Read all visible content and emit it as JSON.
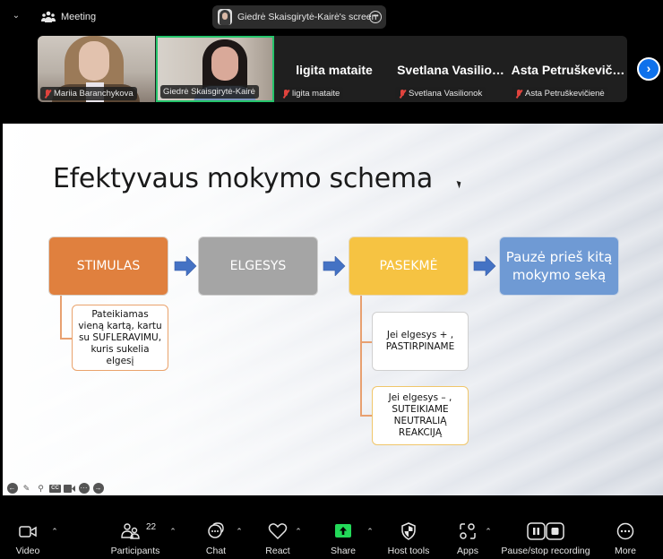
{
  "topbar": {
    "meeting_label": "Meeting",
    "screen_share_label": "Giedrė Skaisgirytė-Kairė's screen",
    "icons": {
      "collapse": "chevron-down-icon",
      "meeting": "people-icon",
      "more": "more-icon"
    }
  },
  "gallery": {
    "participants": [
      {
        "name": "Mariia Baranchykova",
        "display_name": "",
        "video": true,
        "muted": true,
        "active_speaker": false
      },
      {
        "name": "Giedrė Skaisgirytė-Kairė",
        "display_name": "",
        "video": true,
        "muted": false,
        "active_speaker": true
      },
      {
        "name": "ligita mataite",
        "display_name": "ligita mataite",
        "video": false,
        "muted": true,
        "active_speaker": false
      },
      {
        "name": "Svetlana Vasilionok",
        "display_name": "Svetlana  Vasilio…",
        "video": false,
        "muted": true,
        "active_speaker": false
      },
      {
        "name": "Asta Petruškevičienė",
        "display_name": "Asta  Petruškevič…",
        "video": false,
        "muted": true,
        "active_speaker": false
      }
    ],
    "next_icon": "chevron-right-icon"
  },
  "slide": {
    "title": "Efektyvaus mokymo schema",
    "steps": [
      {
        "label": "STIMULAS",
        "color": "#e0803e"
      },
      {
        "label": "ELGESYS",
        "color": "#a5a5a5"
      },
      {
        "label": "PASEKMĖ",
        "color": "#f6c342"
      },
      {
        "label": "Pauzė prieš kitą mokymo seką",
        "color": "#6f9ad4"
      }
    ],
    "arrow_color": "#4472c4",
    "sub_stimulas": "Pateikiamas vieną kartą, kartu su SUFLERAVIMU, kuris sukelia elgesį",
    "sub_positive": "Jei elgesys + , PASTIRPINAME",
    "sub_negative": "Jei elgesys – , SUTEIKIAME NEUTRALIĄ REAKCIJĄ",
    "presenter_tools": [
      "previous-slide-icon",
      "pen-icon",
      "zoom-icon",
      "captions-icon",
      "video-icon",
      "more-icon",
      "next-slide-icon"
    ],
    "presenter_tools_cc": "CC"
  },
  "toolbar": {
    "video": "Video",
    "participants": "Participants",
    "participants_count": "22",
    "chat": "Chat",
    "react": "React",
    "share": "Share",
    "host_tools": "Host tools",
    "apps": "Apps",
    "recording": "Pause/stop recording",
    "more": "More",
    "share_color": "#23d959"
  }
}
